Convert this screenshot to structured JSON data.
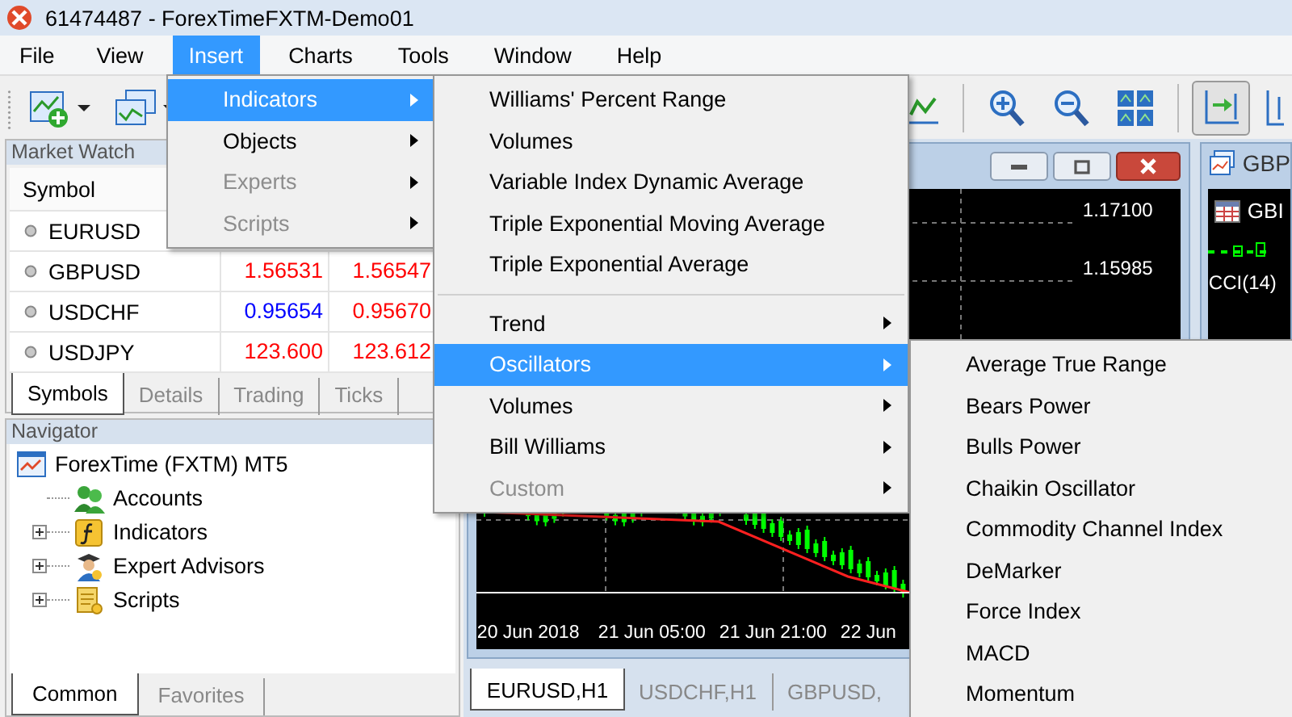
{
  "window": {
    "title": "61474487 - ForexTimeFXTM-Demo01"
  },
  "menu_bar": [
    {
      "label": "File",
      "selected": false
    },
    {
      "label": "View",
      "selected": false
    },
    {
      "label": "Insert",
      "selected": true
    },
    {
      "label": "Charts",
      "selected": false
    },
    {
      "label": "Tools",
      "selected": false
    },
    {
      "label": "Window",
      "selected": false
    },
    {
      "label": "Help",
      "selected": false
    }
  ],
  "toolbar": [
    {
      "kind": "new-chart",
      "dropdown": true,
      "pressed": false
    },
    {
      "kind": "profiles",
      "dropdown": true,
      "pressed": false
    },
    {
      "kind": "line-chart",
      "dropdown": false,
      "pressed": false
    },
    {
      "kind": "zoom-in",
      "dropdown": false,
      "pressed": false
    },
    {
      "kind": "zoom-out",
      "dropdown": false,
      "pressed": false
    },
    {
      "kind": "tile",
      "dropdown": false,
      "pressed": false
    },
    {
      "kind": "scroll-end",
      "dropdown": false,
      "pressed": true
    },
    {
      "kind": "chart-shift",
      "dropdown": false,
      "pressed": false
    }
  ],
  "market_watch": {
    "title": "Market Watch",
    "columns": [
      "Symbol"
    ],
    "rows": [
      {
        "symbol": "EURUSD"
      },
      {
        "symbol": "GBPUSD",
        "bid": {
          "text": "1.56531",
          "color": "#ff0000"
        },
        "ask": {
          "text": "1.56547",
          "color": "#ff0000"
        }
      },
      {
        "symbol": "USDCHF",
        "bid": {
          "text": "0.95654",
          "color": "#0000ff"
        },
        "ask": {
          "text": "0.95670",
          "color": "#ff0000"
        }
      },
      {
        "symbol": "USDJPY",
        "bid": {
          "text": "123.600",
          "color": "#ff0000"
        },
        "ask": {
          "text": "123.612",
          "color": "#ff0000"
        }
      }
    ],
    "tabs": [
      {
        "label": "Symbols",
        "selected": true
      },
      {
        "label": "Details",
        "selected": false
      },
      {
        "label": "Trading",
        "selected": false
      },
      {
        "label": "Ticks",
        "selected": false
      }
    ]
  },
  "navigator": {
    "title": "Navigator",
    "tree": {
      "label": "ForexTime (FXTM) MT5",
      "children": [
        {
          "label": "Accounts",
          "kind": "accounts"
        },
        {
          "label": "Indicators",
          "kind": "indicators",
          "expanded": false
        },
        {
          "label": "Expert Advisors",
          "kind": "experts",
          "expanded": false
        },
        {
          "label": "Scripts",
          "kind": "scripts",
          "expanded": false
        }
      ]
    },
    "tabs": [
      {
        "label": "Common",
        "selected": true
      },
      {
        "label": "Favorites",
        "selected": false
      }
    ]
  },
  "charts": {
    "windows": [
      {
        "price_labels": [
          "1.17100",
          "1.15985"
        ],
        "time_labels": [
          "20 Jun 2018",
          "21 Jun 05:00",
          "21 Jun 21:00",
          "22 Jun"
        ]
      },
      {
        "title": "GBP",
        "subtitle": "GBI",
        "indicator": "CCI(14)"
      }
    ],
    "tabs": [
      {
        "label": "EURUSD,H1",
        "selected": true
      },
      {
        "label": "USDCHF,H1",
        "selected": false
      },
      {
        "label": "GBPUSD,",
        "selected": false
      }
    ]
  },
  "insert_menu": [
    {
      "label": "Indicators",
      "selected": true,
      "disabled": false,
      "submenu": true
    },
    {
      "label": "Objects",
      "selected": false,
      "disabled": false,
      "submenu": true
    },
    {
      "label": "Experts",
      "selected": false,
      "disabled": true,
      "submenu": true
    },
    {
      "label": "Scripts",
      "selected": false,
      "disabled": true,
      "submenu": true
    }
  ],
  "indicators_menu": [
    {
      "kind": "item",
      "label": "Williams' Percent Range",
      "selected": false,
      "disabled": false,
      "submenu": false
    },
    {
      "kind": "item",
      "label": "Volumes",
      "selected": false,
      "disabled": false,
      "submenu": false
    },
    {
      "kind": "item",
      "label": "Variable Index Dynamic Average",
      "selected": false,
      "disabled": false,
      "submenu": false
    },
    {
      "kind": "item",
      "label": "Triple Exponential Moving Average",
      "selected": false,
      "disabled": false,
      "submenu": false
    },
    {
      "kind": "item",
      "label": "Triple Exponential Average",
      "selected": false,
      "disabled": false,
      "submenu": false
    },
    {
      "kind": "separator"
    },
    {
      "kind": "item",
      "label": "Trend",
      "selected": false,
      "disabled": false,
      "submenu": true
    },
    {
      "kind": "item",
      "label": "Oscillators",
      "selected": true,
      "disabled": false,
      "submenu": true
    },
    {
      "kind": "item",
      "label": "Volumes",
      "selected": false,
      "disabled": false,
      "submenu": true
    },
    {
      "kind": "item",
      "label": "Bill Williams",
      "selected": false,
      "disabled": false,
      "submenu": true
    },
    {
      "kind": "item",
      "label": "Custom",
      "selected": false,
      "disabled": true,
      "submenu": true
    }
  ],
  "oscillators_menu": [
    {
      "label": "Average True Range"
    },
    {
      "label": "Bears Power"
    },
    {
      "label": "Bulls Power"
    },
    {
      "label": "Chaikin Oscillator"
    },
    {
      "label": "Commodity Channel Index"
    },
    {
      "label": "DeMarker"
    },
    {
      "label": "Force Index"
    },
    {
      "label": "MACD"
    },
    {
      "label": "Momentum"
    }
  ]
}
